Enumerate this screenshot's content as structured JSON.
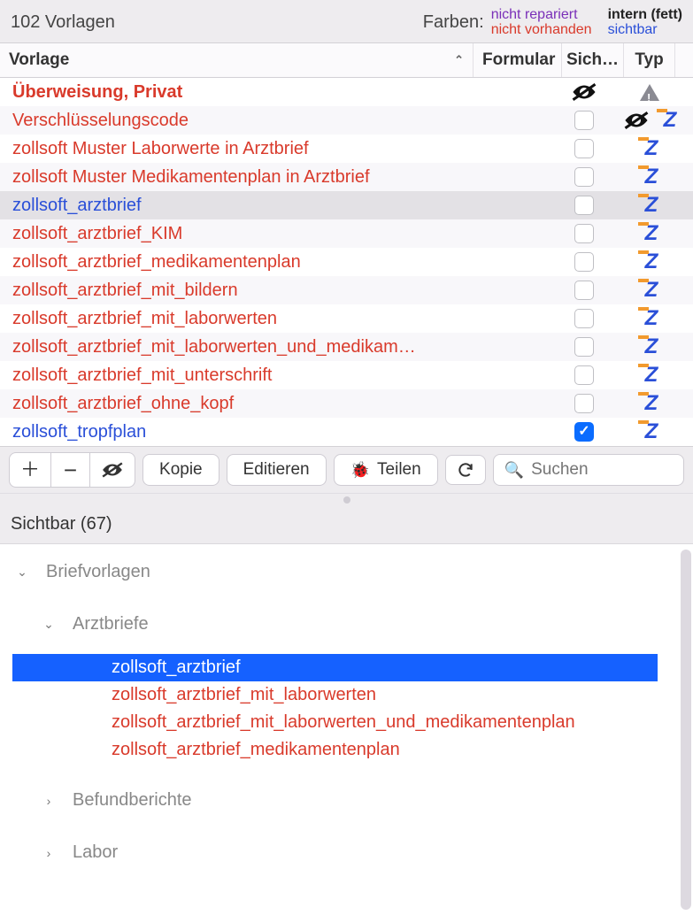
{
  "header": {
    "title": "102 Vorlagen",
    "farben_label": "Farben:",
    "legend": {
      "nicht_repariert": "nicht repariert",
      "nicht_vorhanden": "nicht vorhanden",
      "intern_fett": "intern (fett)",
      "sichtbar": "sichtbar"
    }
  },
  "columns": {
    "vorlage": "Vorlage",
    "formular": "Formular",
    "sichtbar": "Sich…",
    "typ": "Typ"
  },
  "rows": [
    {
      "name": "Überweisung, Privat",
      "style": "txt-red-bold",
      "checkbox": null,
      "sicht_eye": true,
      "typ": "warn",
      "alt": false
    },
    {
      "name": "Verschlüsselungscode",
      "style": "txt-red",
      "checkbox": false,
      "sicht_eye": true,
      "typ": "z",
      "alt": true,
      "typ_pre_eye": true
    },
    {
      "name": "zollsoft Muster Laborwerte in Arztbrief",
      "style": "txt-red",
      "checkbox": false,
      "sicht_eye": false,
      "typ": "z",
      "alt": false
    },
    {
      "name": "zollsoft Muster Medikamentenplan in Arztbrief",
      "style": "txt-red",
      "checkbox": false,
      "sicht_eye": false,
      "typ": "z",
      "alt": true
    },
    {
      "name": "zollsoft_arztbrief",
      "style": "txt-blue",
      "checkbox": false,
      "sicht_eye": false,
      "typ": "z",
      "alt": false,
      "selected": true
    },
    {
      "name": "zollsoft_arztbrief_KIM",
      "style": "txt-red",
      "checkbox": false,
      "sicht_eye": false,
      "typ": "z",
      "alt": true
    },
    {
      "name": "zollsoft_arztbrief_medikamentenplan",
      "style": "txt-red",
      "checkbox": false,
      "sicht_eye": false,
      "typ": "z",
      "alt": false
    },
    {
      "name": "zollsoft_arztbrief_mit_bildern",
      "style": "txt-red",
      "checkbox": false,
      "sicht_eye": false,
      "typ": "z",
      "alt": true
    },
    {
      "name": "zollsoft_arztbrief_mit_laborwerten",
      "style": "txt-red",
      "checkbox": false,
      "sicht_eye": false,
      "typ": "z",
      "alt": false
    },
    {
      "name": "zollsoft_arztbrief_mit_laborwerten_und_medikam…",
      "style": "txt-red",
      "checkbox": false,
      "sicht_eye": false,
      "typ": "z",
      "alt": true
    },
    {
      "name": "zollsoft_arztbrief_mit_unterschrift",
      "style": "txt-red",
      "checkbox": false,
      "sicht_eye": false,
      "typ": "z",
      "alt": false
    },
    {
      "name": "zollsoft_arztbrief_ohne_kopf",
      "style": "txt-red",
      "checkbox": false,
      "sicht_eye": false,
      "typ": "z",
      "alt": true
    },
    {
      "name": "zollsoft_tropfplan",
      "style": "txt-blue",
      "checkbox": true,
      "sicht_eye": false,
      "typ": "z",
      "alt": false
    }
  ],
  "toolbar": {
    "kopie": "Kopie",
    "editieren": "Editieren",
    "teilen": "Teilen",
    "search_placeholder": "Suchen"
  },
  "lower": {
    "title": "Sichtbar (67)",
    "group1": "Briefvorlagen",
    "group2": "Arztbriefe",
    "leaves": [
      {
        "text": "zollsoft_arztbrief",
        "cls": "blue",
        "selected": true
      },
      {
        "text": "zollsoft_arztbrief_mit_laborwerten",
        "cls": "red"
      },
      {
        "text": "zollsoft_arztbrief_mit_laborwerten_und_medikamentenplan",
        "cls": "red"
      },
      {
        "text": "zollsoft_arztbrief_medikamentenplan",
        "cls": "red"
      }
    ],
    "group3": "Befundberichte",
    "group4": "Labor"
  }
}
